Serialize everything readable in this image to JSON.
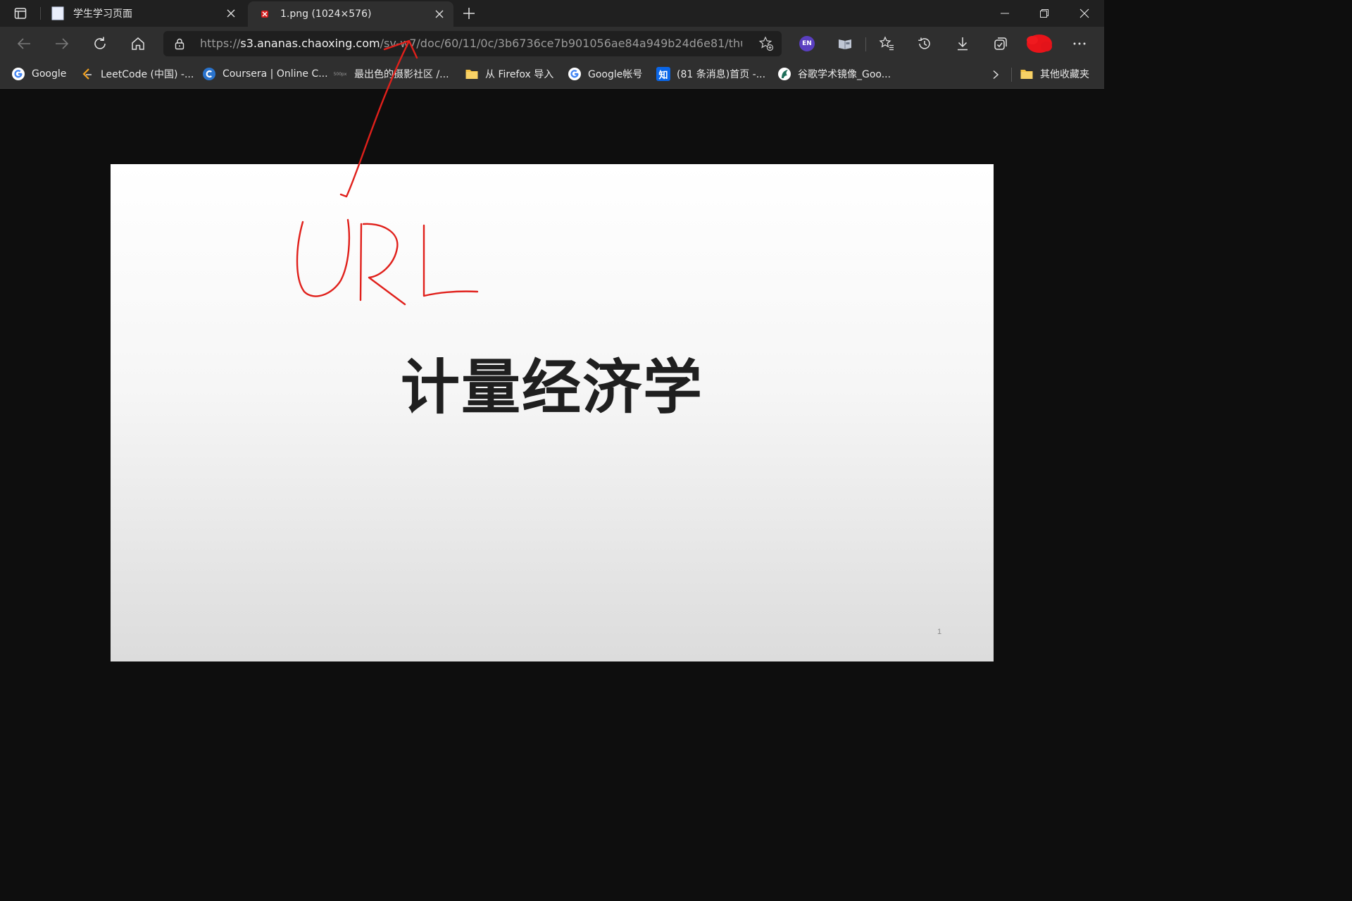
{
  "tabs": [
    {
      "title": "学生学习页面",
      "favicon": "blank-page-icon",
      "active": false
    },
    {
      "title": "1.png (1024×576)",
      "favicon": "chaoxing-favicon",
      "active": true
    }
  ],
  "address_bar": {
    "url_scheme": "https://",
    "url_host": "s3.ananas.chaoxing.com",
    "url_path": "/sv-w7/doc/60/11/0c/3b6736ce7b901056ae84a949b24d6e81/thumb..."
  },
  "extensions": {
    "translate_label": "EN"
  },
  "bookmarks": [
    {
      "label": "Google",
      "icon": "google-icon"
    },
    {
      "label": "LeetCode (中国) -...",
      "icon": "leetcode-icon"
    },
    {
      "label": "Coursera | Online C...",
      "icon": "coursera-icon"
    },
    {
      "label": "最出色的摄影社区 /...",
      "icon": "500px-icon",
      "icon_text": "500px"
    },
    {
      "label": "从 Firefox 导入",
      "icon": "folder-icon"
    },
    {
      "label": "Google帐号",
      "icon": "google-icon"
    },
    {
      "label": "(81 条消息)首页 -...",
      "icon": "zhihu-icon",
      "icon_text": "知"
    },
    {
      "label": "谷歌学术镜像_Goo...",
      "icon": "scholar-mirror-icon"
    }
  ],
  "other_favorites": {
    "label": "其他收藏夹",
    "icon": "folder-icon"
  },
  "slide": {
    "title": "计量经济学",
    "page_number": "1"
  },
  "annotation": {
    "text": "URL",
    "color": "#e0201b"
  },
  "colors": {
    "titlebar": "#202020",
    "toolbar": "#2f2f2f",
    "viewer_bg": "#0e0e0e"
  }
}
